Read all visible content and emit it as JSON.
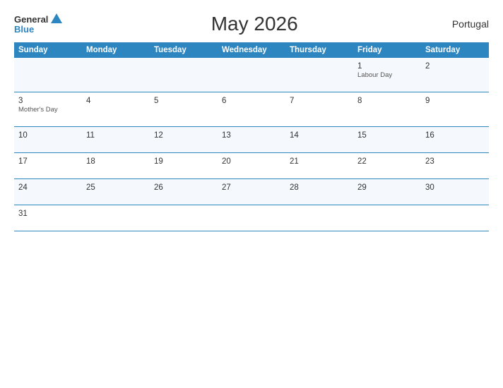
{
  "header": {
    "title": "May 2026",
    "country": "Portugal",
    "logo_general": "General",
    "logo_blue": "Blue"
  },
  "weekdays": [
    "Sunday",
    "Monday",
    "Tuesday",
    "Wednesday",
    "Thursday",
    "Friday",
    "Saturday"
  ],
  "weeks": [
    [
      {
        "day": "",
        "holiday": ""
      },
      {
        "day": "",
        "holiday": ""
      },
      {
        "day": "",
        "holiday": ""
      },
      {
        "day": "",
        "holiday": ""
      },
      {
        "day": "",
        "holiday": ""
      },
      {
        "day": "1",
        "holiday": "Labour Day"
      },
      {
        "day": "2",
        "holiday": ""
      }
    ],
    [
      {
        "day": "3",
        "holiday": "Mother's Day"
      },
      {
        "day": "4",
        "holiday": ""
      },
      {
        "day": "5",
        "holiday": ""
      },
      {
        "day": "6",
        "holiday": ""
      },
      {
        "day": "7",
        "holiday": ""
      },
      {
        "day": "8",
        "holiday": ""
      },
      {
        "day": "9",
        "holiday": ""
      }
    ],
    [
      {
        "day": "10",
        "holiday": ""
      },
      {
        "day": "11",
        "holiday": ""
      },
      {
        "day": "12",
        "holiday": ""
      },
      {
        "day": "13",
        "holiday": ""
      },
      {
        "day": "14",
        "holiday": ""
      },
      {
        "day": "15",
        "holiday": ""
      },
      {
        "day": "16",
        "holiday": ""
      }
    ],
    [
      {
        "day": "17",
        "holiday": ""
      },
      {
        "day": "18",
        "holiday": ""
      },
      {
        "day": "19",
        "holiday": ""
      },
      {
        "day": "20",
        "holiday": ""
      },
      {
        "day": "21",
        "holiday": ""
      },
      {
        "day": "22",
        "holiday": ""
      },
      {
        "day": "23",
        "holiday": ""
      }
    ],
    [
      {
        "day": "24",
        "holiday": ""
      },
      {
        "day": "25",
        "holiday": ""
      },
      {
        "day": "26",
        "holiday": ""
      },
      {
        "day": "27",
        "holiday": ""
      },
      {
        "day": "28",
        "holiday": ""
      },
      {
        "day": "29",
        "holiday": ""
      },
      {
        "day": "30",
        "holiday": ""
      }
    ],
    [
      {
        "day": "31",
        "holiday": ""
      },
      {
        "day": "",
        "holiday": ""
      },
      {
        "day": "",
        "holiday": ""
      },
      {
        "day": "",
        "holiday": ""
      },
      {
        "day": "",
        "holiday": ""
      },
      {
        "day": "",
        "holiday": ""
      },
      {
        "day": "",
        "holiday": ""
      }
    ]
  ]
}
